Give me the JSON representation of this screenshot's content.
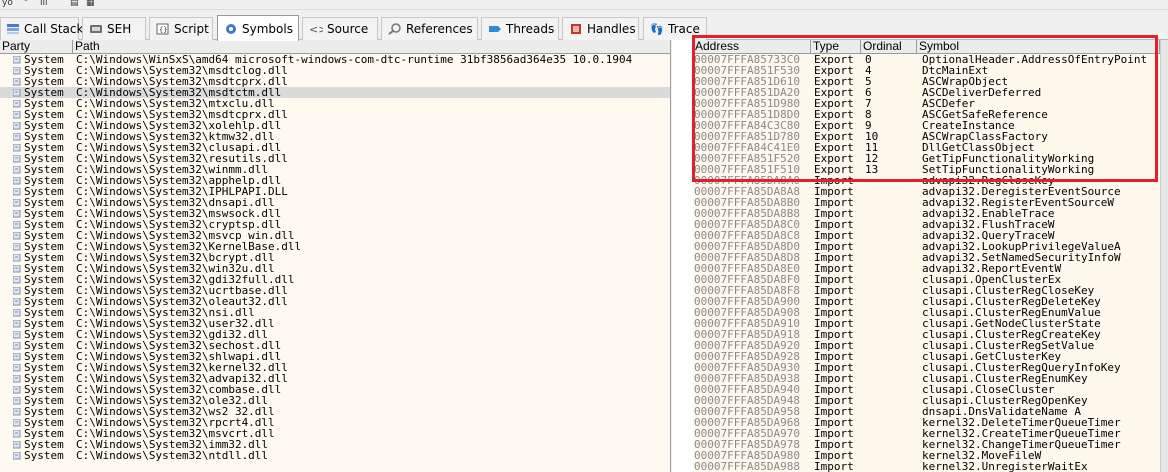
{
  "toolbar": {
    "mini_glyphs": [
      "yo",
      "\"",
      "ııı",
      "▤",
      "▦"
    ]
  },
  "tabs": [
    {
      "label": "Call Stack",
      "icon": "call-stack-icon",
      "active": false
    },
    {
      "label": "SEH",
      "icon": "seh-icon",
      "active": false
    },
    {
      "label": "Script",
      "icon": "script-icon",
      "active": false
    },
    {
      "label": "Symbols",
      "icon": "symbols-icon",
      "active": true
    },
    {
      "label": "Source",
      "icon": "source-icon",
      "active": false
    },
    {
      "label": "References",
      "icon": "references-icon",
      "active": false
    },
    {
      "label": "Threads",
      "icon": "threads-icon",
      "active": false
    },
    {
      "label": "Handles",
      "icon": "handles-icon",
      "active": false
    },
    {
      "label": "Trace",
      "icon": "trace-icon",
      "active": false
    }
  ],
  "modules": {
    "columns": [
      "Party",
      "Path"
    ],
    "selected_index": 3,
    "rows": [
      {
        "party": "System",
        "path": "C:\\Windows\\WinSxS\\amd64_microsoft-windows-com-dtc-runtime_31bf3856ad364e35_10.0.1904"
      },
      {
        "party": "System",
        "path": "C:\\Windows\\System32\\msdtclog.dll"
      },
      {
        "party": "System",
        "path": "C:\\Windows\\System32\\msdtcprx.dll"
      },
      {
        "party": "System",
        "path": "C:\\Windows\\System32\\msdtctm.dll"
      },
      {
        "party": "System",
        "path": "C:\\Windows\\System32\\mtxclu.dll"
      },
      {
        "party": "System",
        "path": "C:\\Windows\\System32\\msdtcprx.dll"
      },
      {
        "party": "System",
        "path": "C:\\Windows\\System32\\xolehlp.dll"
      },
      {
        "party": "System",
        "path": "C:\\Windows\\System32\\ktmw32.dll"
      },
      {
        "party": "System",
        "path": "C:\\Windows\\System32\\clusapi.dll"
      },
      {
        "party": "System",
        "path": "C:\\Windows\\System32\\resutils.dll"
      },
      {
        "party": "System",
        "path": "C:\\Windows\\System32\\winmm.dll"
      },
      {
        "party": "System",
        "path": "C:\\Windows\\System32\\apphelp.dll"
      },
      {
        "party": "System",
        "path": "C:\\Windows\\System32\\IPHLPAPI.DLL"
      },
      {
        "party": "System",
        "path": "C:\\Windows\\System32\\dnsapi.dll"
      },
      {
        "party": "System",
        "path": "C:\\Windows\\System32\\mswsock.dll"
      },
      {
        "party": "System",
        "path": "C:\\Windows\\System32\\cryptsp.dll"
      },
      {
        "party": "System",
        "path": "C:\\Windows\\System32\\msvcp_win.dll"
      },
      {
        "party": "System",
        "path": "C:\\Windows\\System32\\KernelBase.dll"
      },
      {
        "party": "System",
        "path": "C:\\Windows\\System32\\bcrypt.dll"
      },
      {
        "party": "System",
        "path": "C:\\Windows\\System32\\win32u.dll"
      },
      {
        "party": "System",
        "path": "C:\\Windows\\System32\\gdi32full.dll"
      },
      {
        "party": "System",
        "path": "C:\\Windows\\System32\\ucrtbase.dll"
      },
      {
        "party": "System",
        "path": "C:\\Windows\\System32\\oleaut32.dll"
      },
      {
        "party": "System",
        "path": "C:\\Windows\\System32\\nsi.dll"
      },
      {
        "party": "System",
        "path": "C:\\Windows\\System32\\user32.dll"
      },
      {
        "party": "System",
        "path": "C:\\Windows\\System32\\gdi32.dll"
      },
      {
        "party": "System",
        "path": "C:\\Windows\\System32\\sechost.dll"
      },
      {
        "party": "System",
        "path": "C:\\Windows\\System32\\shlwapi.dll"
      },
      {
        "party": "System",
        "path": "C:\\Windows\\System32\\kernel32.dll"
      },
      {
        "party": "System",
        "path": "C:\\Windows\\System32\\advapi32.dll"
      },
      {
        "party": "System",
        "path": "C:\\Windows\\System32\\combase.dll"
      },
      {
        "party": "System",
        "path": "C:\\Windows\\System32\\ole32.dll"
      },
      {
        "party": "System",
        "path": "C:\\Windows\\System32\\ws2_32.dll"
      },
      {
        "party": "System",
        "path": "C:\\Windows\\System32\\rpcrt4.dll"
      },
      {
        "party": "System",
        "path": "C:\\Windows\\System32\\msvcrt.dll"
      },
      {
        "party": "System",
        "path": "C:\\Windows\\System32\\imm32.dll"
      },
      {
        "party": "System",
        "path": "C:\\Windows\\System32\\ntdll.dll"
      }
    ]
  },
  "symbols": {
    "columns": [
      "Address",
      "Type",
      "Ordinal",
      "Symbol"
    ],
    "rows": [
      {
        "address": "00007FFFA85733C0",
        "type": "Export",
        "ordinal": "0",
        "symbol": "OptionalHeader.AddressOfEntryPoint"
      },
      {
        "address": "00007FFFA851F530",
        "type": "Export",
        "ordinal": "4",
        "symbol": "DtcMainExt"
      },
      {
        "address": "00007FFFA851D610",
        "type": "Export",
        "ordinal": "5",
        "symbol": "ASCWrapObject"
      },
      {
        "address": "00007FFFA851DA20",
        "type": "Export",
        "ordinal": "6",
        "symbol": "ASCDeliverDeferred"
      },
      {
        "address": "00007FFFA851D980",
        "type": "Export",
        "ordinal": "7",
        "symbol": "ASCDefer"
      },
      {
        "address": "00007FFFA851D8D0",
        "type": "Export",
        "ordinal": "8",
        "symbol": "ASCGetSafeReference"
      },
      {
        "address": "00007FFFA84C3C80",
        "type": "Export",
        "ordinal": "9",
        "symbol": "CreateInstance"
      },
      {
        "address": "00007FFFA851D780",
        "type": "Export",
        "ordinal": "10",
        "symbol": "ASCWrapClassFactory"
      },
      {
        "address": "00007FFFA84C41E0",
        "type": "Export",
        "ordinal": "11",
        "symbol": "DllGetClassObject"
      },
      {
        "address": "00007FFFA851F520",
        "type": "Export",
        "ordinal": "12",
        "symbol": "GetTipFunctionalityWorking"
      },
      {
        "address": "00007FFFA851F510",
        "type": "Export",
        "ordinal": "13",
        "symbol": "SetTipFunctionalityWorking"
      },
      {
        "address": "00007FFFA85DA8A0",
        "type": "Import",
        "ordinal": "",
        "symbol": "advapi32.RegCloseKey"
      },
      {
        "address": "00007FFFA85DA8A8",
        "type": "Import",
        "ordinal": "",
        "symbol": "advapi32.DeregisterEventSource"
      },
      {
        "address": "00007FFFA85DA8B0",
        "type": "Import",
        "ordinal": "",
        "symbol": "advapi32.RegisterEventSourceW"
      },
      {
        "address": "00007FFFA85DA8B8",
        "type": "Import",
        "ordinal": "",
        "symbol": "advapi32.EnableTrace"
      },
      {
        "address": "00007FFFA85DA8C0",
        "type": "Import",
        "ordinal": "",
        "symbol": "advapi32.FlushTraceW"
      },
      {
        "address": "00007FFFA85DA8C8",
        "type": "Import",
        "ordinal": "",
        "symbol": "advapi32.QueryTraceW"
      },
      {
        "address": "00007FFFA85DA8D0",
        "type": "Import",
        "ordinal": "",
        "symbol": "advapi32.LookupPrivilegeValueA"
      },
      {
        "address": "00007FFFA85DA8D8",
        "type": "Import",
        "ordinal": "",
        "symbol": "advapi32.SetNamedSecurityInfoW"
      },
      {
        "address": "00007FFFA85DA8E0",
        "type": "Import",
        "ordinal": "",
        "symbol": "advapi32.ReportEventW"
      },
      {
        "address": "00007FFFA85DA8F0",
        "type": "Import",
        "ordinal": "",
        "symbol": "clusapi.OpenClusterEx"
      },
      {
        "address": "00007FFFA85DA8F8",
        "type": "Import",
        "ordinal": "",
        "symbol": "clusapi.ClusterRegCloseKey"
      },
      {
        "address": "00007FFFA85DA900",
        "type": "Import",
        "ordinal": "",
        "symbol": "clusapi.ClusterRegDeleteKey"
      },
      {
        "address": "00007FFFA85DA908",
        "type": "Import",
        "ordinal": "",
        "symbol": "clusapi.ClusterRegEnumValue"
      },
      {
        "address": "00007FFFA85DA910",
        "type": "Import",
        "ordinal": "",
        "symbol": "clusapi.GetNodeClusterState"
      },
      {
        "address": "00007FFFA85DA918",
        "type": "Import",
        "ordinal": "",
        "symbol": "clusapi.ClusterRegCreateKey"
      },
      {
        "address": "00007FFFA85DA920",
        "type": "Import",
        "ordinal": "",
        "symbol": "clusapi.ClusterRegSetValue"
      },
      {
        "address": "00007FFFA85DA928",
        "type": "Import",
        "ordinal": "",
        "symbol": "clusapi.GetClusterKey"
      },
      {
        "address": "00007FFFA85DA930",
        "type": "Import",
        "ordinal": "",
        "symbol": "clusapi.ClusterRegQueryInfoKey"
      },
      {
        "address": "00007FFFA85DA938",
        "type": "Import",
        "ordinal": "",
        "symbol": "clusapi.ClusterRegEnumKey"
      },
      {
        "address": "00007FFFA85DA940",
        "type": "Import",
        "ordinal": "",
        "symbol": "clusapi.CloseCluster"
      },
      {
        "address": "00007FFFA85DA948",
        "type": "Import",
        "ordinal": "",
        "symbol": "clusapi.ClusterRegOpenKey"
      },
      {
        "address": "00007FFFA85DA958",
        "type": "Import",
        "ordinal": "",
        "symbol": "dnsapi.DnsValidateName_A"
      },
      {
        "address": "00007FFFA85DA968",
        "type": "Import",
        "ordinal": "",
        "symbol": "kernel32.DeleteTimerQueueTimer"
      },
      {
        "address": "00007FFFA85DA970",
        "type": "Import",
        "ordinal": "",
        "symbol": "kernel32.CreateTimerQueueTimer"
      },
      {
        "address": "00007FFFA85DA978",
        "type": "Import",
        "ordinal": "",
        "symbol": "kernel32.ChangeTimerQueueTimer"
      },
      {
        "address": "00007FFFA85DA980",
        "type": "Import",
        "ordinal": "",
        "symbol": "kernel32.MoveFileW"
      },
      {
        "address": "00007FFFA85DA988",
        "type": "Import",
        "ordinal": "",
        "symbol": "kernel32.UnregisterWaitEx"
      }
    ]
  },
  "colors": {
    "highlight_border": "#e4202c",
    "row_selected": "#dadada",
    "pane_background": "#fffaf0",
    "address_text": "#8a8a8a"
  }
}
